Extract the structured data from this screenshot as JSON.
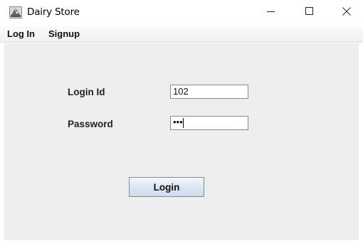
{
  "window": {
    "title": "Dairy Store",
    "icon": "app-icon"
  },
  "window_controls": {
    "minimize_icon": "minimize-icon",
    "maximize_icon": "maximize-icon",
    "close_icon": "close-icon"
  },
  "menubar": {
    "items": [
      {
        "label": "Log In"
      },
      {
        "label": "Signup"
      }
    ]
  },
  "form": {
    "login_id_label": "Login Id",
    "login_id_value": "102",
    "password_label": "Password",
    "password_value": "•••",
    "login_button_label": "Login"
  },
  "colors": {
    "panel_background": "#eeeeee",
    "field_border": "#7a8a99",
    "button_border": "#7b8aa0"
  }
}
